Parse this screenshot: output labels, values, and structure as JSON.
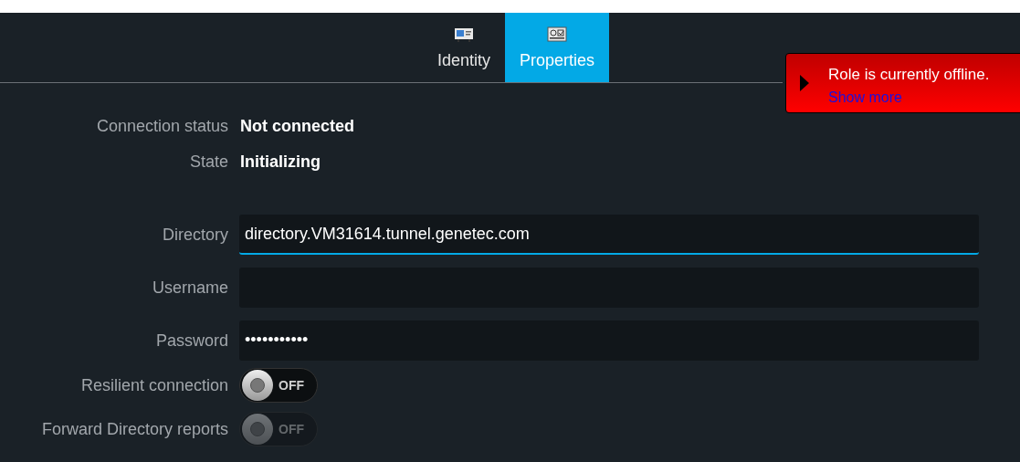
{
  "tabs": [
    {
      "label": "Identity",
      "kind": "identity",
      "selected": false
    },
    {
      "label": "Properties",
      "kind": "properties",
      "selected": true
    }
  ],
  "notification": {
    "message": "Role is currently offline.",
    "link": "Show more"
  },
  "status": [
    {
      "label": "Connection status",
      "value": "Not connected"
    },
    {
      "label": "State",
      "value": "Initializing"
    }
  ],
  "fields": [
    {
      "label": "Directory",
      "value": "directory.VM31614.tunnel.genetec.com",
      "focused": true
    },
    {
      "label": "Username",
      "focused": false
    },
    {
      "label": "Password",
      "value": "•••••••••••",
      "focused": false
    }
  ],
  "toggles": [
    {
      "label": "Resilient connection",
      "text": "OFF",
      "on": false,
      "disabled": false
    },
    {
      "label": "Forward Directory reports",
      "text": "OFF",
      "on": false,
      "disabled": true
    }
  ]
}
